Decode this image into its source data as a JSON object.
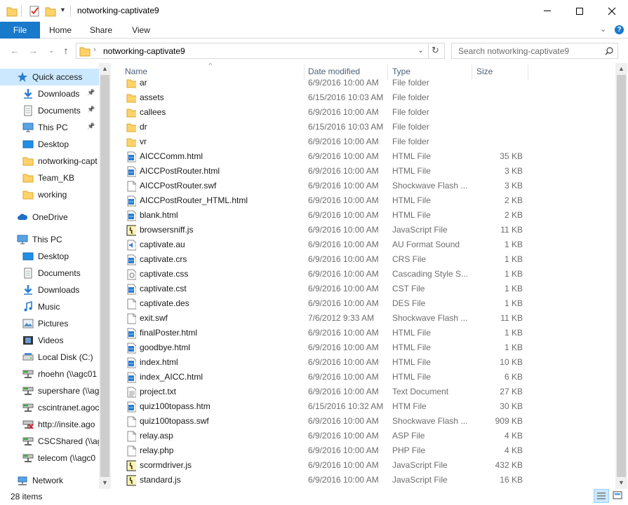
{
  "window": {
    "title": "notworking-captivate9",
    "controls": {
      "minimize": "—",
      "maximize": "☐",
      "close": "✕"
    }
  },
  "ribbon": {
    "tabs": [
      "File",
      "Home",
      "Share",
      "View"
    ]
  },
  "address": {
    "path": "notworking-captivate9",
    "search_placeholder": "Search notworking-captivate9"
  },
  "nav": {
    "items": [
      {
        "label": "Quick access",
        "icon": "star-icon",
        "pinned": false,
        "selected": true
      },
      {
        "label": "Downloads",
        "icon": "download-arrow-icon",
        "pinned": true
      },
      {
        "label": "Documents",
        "icon": "documents-icon",
        "pinned": true
      },
      {
        "label": "This PC",
        "icon": "monitor-icon",
        "pinned": true
      },
      {
        "label": "Desktop",
        "icon": "desktop-icon",
        "pinned": false
      },
      {
        "label": "notworking-capt",
        "icon": "folder-icon",
        "pinned": false
      },
      {
        "label": "Team_KB",
        "icon": "folder-icon",
        "pinned": false
      },
      {
        "label": "working",
        "icon": "folder-icon",
        "pinned": false
      },
      {
        "label": "OneDrive",
        "icon": "cloud-icon",
        "pinned": false
      },
      {
        "label": "This PC",
        "icon": "monitor-icon",
        "pinned": false
      },
      {
        "label": "Desktop",
        "icon": "desktop-icon",
        "pinned": false
      },
      {
        "label": "Documents",
        "icon": "documents-icon",
        "pinned": false
      },
      {
        "label": "Downloads",
        "icon": "download-arrow-icon",
        "pinned": false
      },
      {
        "label": "Music",
        "icon": "music-note-icon",
        "pinned": false
      },
      {
        "label": "Pictures",
        "icon": "pictures-icon",
        "pinned": false
      },
      {
        "label": "Videos",
        "icon": "film-icon",
        "pinned": false
      },
      {
        "label": "Local Disk (C:)",
        "icon": "disk-icon",
        "pinned": false
      },
      {
        "label": "rhoehn (\\\\agc01",
        "icon": "network-drive-icon",
        "pinned": false
      },
      {
        "label": "supershare (\\\\ag",
        "icon": "network-drive-icon",
        "pinned": false
      },
      {
        "label": "cscintranet.agoc",
        "icon": "network-drive-icon",
        "pinned": false
      },
      {
        "label": "http://insite.ago",
        "icon": "disconnected-drive-icon",
        "pinned": false
      },
      {
        "label": "CSCShared (\\\\ag",
        "icon": "network-drive-icon",
        "pinned": false
      },
      {
        "label": "telecom (\\\\agc0",
        "icon": "network-drive-icon",
        "pinned": false
      },
      {
        "label": "Network",
        "icon": "network-icon",
        "pinned": false
      }
    ]
  },
  "columns": {
    "name": "Name",
    "date": "Date modified",
    "type": "Type",
    "size": "Size"
  },
  "files": [
    {
      "name": "ar",
      "date": "6/9/2016 10:00 AM",
      "type": "File folder",
      "size": "",
      "icon": "folder-icon"
    },
    {
      "name": "assets",
      "date": "6/15/2016 10:03 AM",
      "type": "File folder",
      "size": "",
      "icon": "folder-icon"
    },
    {
      "name": "callees",
      "date": "6/9/2016 10:00 AM",
      "type": "File folder",
      "size": "",
      "icon": "folder-icon"
    },
    {
      "name": "dr",
      "date": "6/15/2016 10:03 AM",
      "type": "File folder",
      "size": "",
      "icon": "folder-icon"
    },
    {
      "name": "vr",
      "date": "6/9/2016 10:00 AM",
      "type": "File folder",
      "size": "",
      "icon": "folder-icon"
    },
    {
      "name": "AICCComm.html",
      "date": "6/9/2016 10:00 AM",
      "type": "HTML File",
      "size": "35 KB",
      "icon": "html-file-icon"
    },
    {
      "name": "AICCPostRouter.html",
      "date": "6/9/2016 10:00 AM",
      "type": "HTML File",
      "size": "3 KB",
      "icon": "html-file-icon"
    },
    {
      "name": "AICCPostRouter.swf",
      "date": "6/9/2016 10:00 AM",
      "type": "Shockwave Flash ...",
      "size": "3 KB",
      "icon": "blank-file-icon"
    },
    {
      "name": "AICCPostRouter_HTML.html",
      "date": "6/9/2016 10:00 AM",
      "type": "HTML File",
      "size": "2 KB",
      "icon": "html-file-icon"
    },
    {
      "name": "blank.html",
      "date": "6/9/2016 10:00 AM",
      "type": "HTML File",
      "size": "2 KB",
      "icon": "html-file-icon"
    },
    {
      "name": "browsersniff.js",
      "date": "6/9/2016 10:00 AM",
      "type": "JavaScript File",
      "size": "11 KB",
      "icon": "script-file-icon"
    },
    {
      "name": "captivate.au",
      "date": "6/9/2016 10:00 AM",
      "type": "AU Format Sound",
      "size": "1 KB",
      "icon": "sound-file-icon"
    },
    {
      "name": "captivate.crs",
      "date": "6/9/2016 10:00 AM",
      "type": "CRS File",
      "size": "1 KB",
      "icon": "html-file-icon"
    },
    {
      "name": "captivate.css",
      "date": "6/9/2016 10:00 AM",
      "type": "Cascading Style S...",
      "size": "1 KB",
      "icon": "css-file-icon"
    },
    {
      "name": "captivate.cst",
      "date": "6/9/2016 10:00 AM",
      "type": "CST File",
      "size": "1 KB",
      "icon": "html-file-icon"
    },
    {
      "name": "captivate.des",
      "date": "6/9/2016 10:00 AM",
      "type": "DES File",
      "size": "1 KB",
      "icon": "blank-file-icon"
    },
    {
      "name": "exit.swf",
      "date": "7/6/2012 9:33 AM",
      "type": "Shockwave Flash ...",
      "size": "11 KB",
      "icon": "blank-file-icon"
    },
    {
      "name": "finalPoster.html",
      "date": "6/9/2016 10:00 AM",
      "type": "HTML File",
      "size": "1 KB",
      "icon": "html-file-icon"
    },
    {
      "name": "goodbye.html",
      "date": "6/9/2016 10:00 AM",
      "type": "HTML File",
      "size": "1 KB",
      "icon": "html-file-icon"
    },
    {
      "name": "index.html",
      "date": "6/9/2016 10:00 AM",
      "type": "HTML File",
      "size": "10 KB",
      "icon": "html-file-icon"
    },
    {
      "name": "index_AICC.html",
      "date": "6/9/2016 10:00 AM",
      "type": "HTML File",
      "size": "6 KB",
      "icon": "html-file-icon"
    },
    {
      "name": "project.txt",
      "date": "6/9/2016 10:00 AM",
      "type": "Text Document",
      "size": "27 KB",
      "icon": "text-file-icon"
    },
    {
      "name": "quiz100topass.htm",
      "date": "6/15/2016 10:32 AM",
      "type": "HTM File",
      "size": "30 KB",
      "icon": "html-file-icon"
    },
    {
      "name": "quiz100topass.swf",
      "date": "6/9/2016 10:00 AM",
      "type": "Shockwave Flash ...",
      "size": "909 KB",
      "icon": "blank-file-icon"
    },
    {
      "name": "relay.asp",
      "date": "6/9/2016 10:00 AM",
      "type": "ASP File",
      "size": "4 KB",
      "icon": "blank-file-icon"
    },
    {
      "name": "relay.php",
      "date": "6/9/2016 10:00 AM",
      "type": "PHP File",
      "size": "4 KB",
      "icon": "blank-file-icon"
    },
    {
      "name": "scormdriver.js",
      "date": "6/9/2016 10:00 AM",
      "type": "JavaScript File",
      "size": "432 KB",
      "icon": "script-file-icon"
    },
    {
      "name": "standard.js",
      "date": "6/9/2016 10:00 AM",
      "type": "JavaScript File",
      "size": "16 KB",
      "icon": "script-file-icon"
    }
  ],
  "status": {
    "item_count": "28 items"
  },
  "colors": {
    "accent": "#1979ca",
    "selection": "#cce8ff",
    "folder": "#ffd26a",
    "header_text": "#4c607a"
  }
}
